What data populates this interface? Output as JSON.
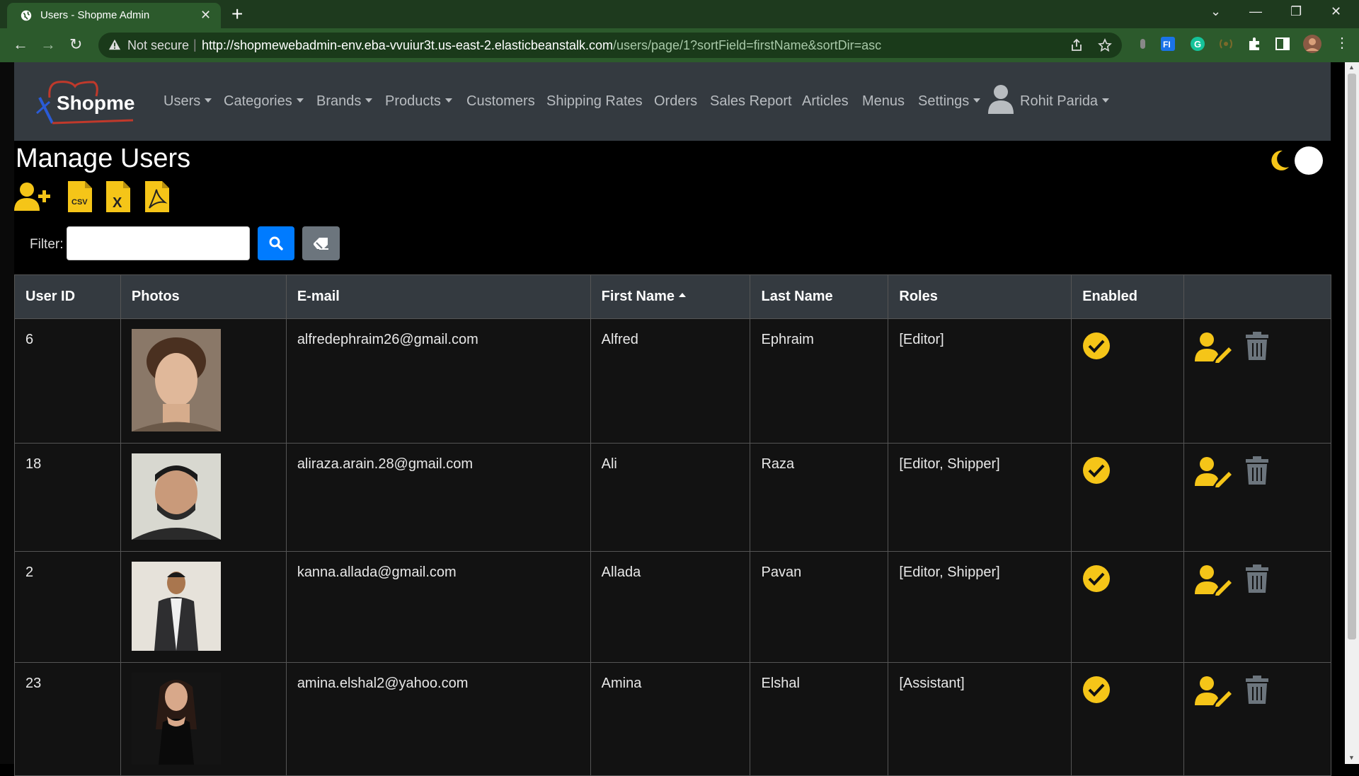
{
  "browser": {
    "tab_title": "Users - Shopme Admin",
    "not_secure": "Not secure",
    "url_host": "http://shopmewebadmin-env.eba-vvuiur3t.us-east-2.elasticbeanstalk.com",
    "url_path": "/users/page/1?sortField=firstName&sortDir=asc"
  },
  "navbar": {
    "logo": "Shopme",
    "items": [
      "Users",
      "Categories",
      "Brands",
      "Products",
      "Customers",
      "Shipping Rates",
      "Orders",
      "Sales Report",
      "Articles",
      "Menus",
      "Settings"
    ],
    "user": "Rohit Parida"
  },
  "page": {
    "title": "Manage Users",
    "filter_label": "Filter:",
    "filter_value": ""
  },
  "table": {
    "headers": [
      "User ID",
      "Photos",
      "E-mail",
      "First Name",
      "Last Name",
      "Roles",
      "Enabled",
      ""
    ],
    "rows": [
      {
        "id": "6",
        "email": "alfredephraim26@gmail.com",
        "first": "Alfred",
        "last": "Ephraim",
        "roles": "[Editor]"
      },
      {
        "id": "18",
        "email": "aliraza.arain.28@gmail.com",
        "first": "Ali",
        "last": "Raza",
        "roles": "[Editor, Shipper]"
      },
      {
        "id": "2",
        "email": "kanna.allada@gmail.com",
        "first": "Allada",
        "last": "Pavan",
        "roles": "[Editor, Shipper]"
      },
      {
        "id": "23",
        "email": "amina.elshal2@yahoo.com",
        "first": "Amina",
        "last": "Elshal",
        "roles": "[Assistant]"
      }
    ]
  },
  "colors": {
    "accent": "#f5c518",
    "navbar": "#343a40",
    "primary": "#007bff",
    "secondary": "#6c757d"
  }
}
